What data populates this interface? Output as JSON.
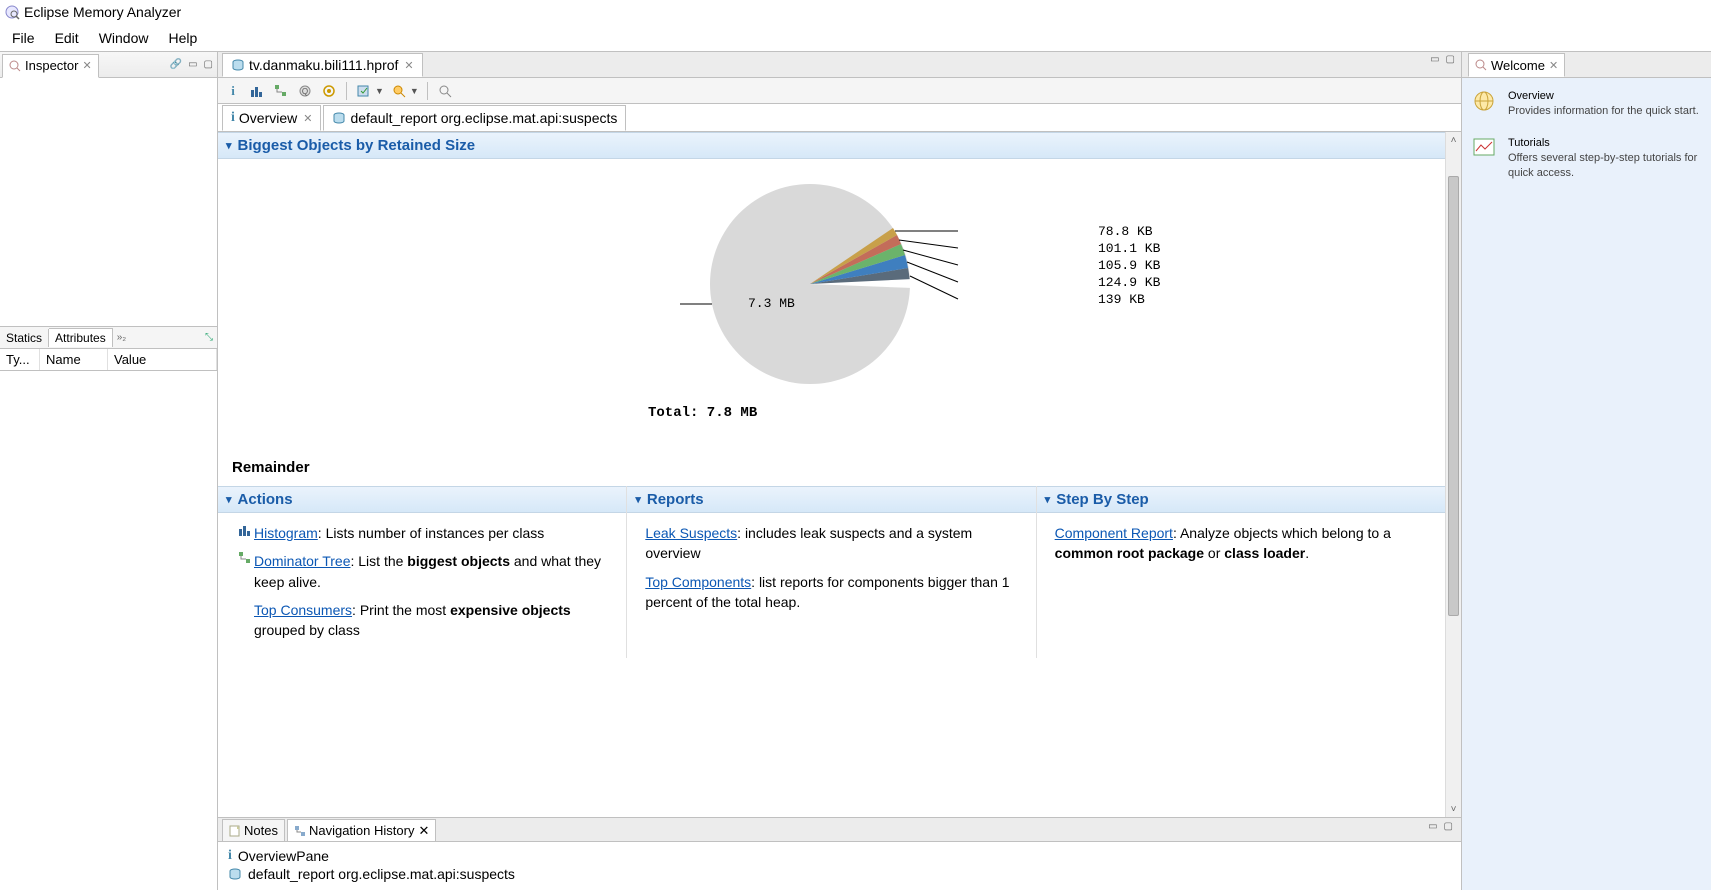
{
  "app_title": "Eclipse Memory Analyzer",
  "menubar": [
    "File",
    "Edit",
    "Window",
    "Help"
  ],
  "left_view": {
    "title": "Inspector"
  },
  "attr_tabs": {
    "statics": "Statics",
    "attributes": "Attributes",
    "col1": "Ty...",
    "col2": "Name",
    "col3": "Value"
  },
  "editor_tab": "tv.danmaku.bili111.hprof",
  "inner_tabs": {
    "overview": "Overview",
    "default_report": "default_report  org.eclipse.mat.api:suspects"
  },
  "sections": {
    "biggest": "Biggest Objects by Retained Size",
    "remainder": "Remainder",
    "actions": "Actions",
    "reports": "Reports",
    "stepbystep": "Step By Step"
  },
  "chart_data": {
    "type": "pie",
    "title": "",
    "total_label": "Total: 7.8 MB",
    "slices": [
      {
        "label": "7.3 MB",
        "value_mb": 7.3,
        "color": "#d9d9d9"
      },
      {
        "label": "78.8 KB",
        "value_kb": 78.8,
        "color": "#c8a04a"
      },
      {
        "label": "101.1 KB",
        "value_kb": 101.1,
        "color": "#c36d5a"
      },
      {
        "label": "105.9 KB",
        "value_kb": 105.9,
        "color": "#6bb36b"
      },
      {
        "label": "124.9 KB",
        "value_kb": 124.9,
        "color": "#3f7fbf"
      },
      {
        "label": "139 KB",
        "value_kb": 139,
        "color": "#5a6b7b"
      }
    ]
  },
  "actions_col": {
    "histogram": {
      "link": "Histogram",
      "rest": ": Lists number of instances per class"
    },
    "dominator": {
      "link": "Dominator Tree",
      "rest1": ": List the ",
      "bold": "biggest objects",
      "rest2": " and what they keep alive."
    },
    "topconsumers": {
      "link": "Top Consumers",
      "rest1": ": Print the most ",
      "bold": "expensive objects",
      "rest2": " grouped by class"
    }
  },
  "reports_col": {
    "leak": {
      "link": "Leak Suspects",
      "rest": ": includes leak suspects and a system overview"
    },
    "topcomp": {
      "link": "Top Components",
      "rest": ": list reports for components bigger than 1 percent of the total heap."
    }
  },
  "step_col": {
    "comprep": {
      "link": "Component Report",
      "rest1": ": Analyze objects which belong to a ",
      "bold1": "common root package",
      "or": " or ",
      "bold2": "class loader",
      "dot": "."
    }
  },
  "bottom": {
    "notes_tab": "Notes",
    "nav_tab": "Navigation History",
    "row1": "OverviewPane",
    "row2": "default_report  org.eclipse.mat.api:suspects"
  },
  "welcome": {
    "tab": "Welcome",
    "overview_title": "Overview",
    "overview_desc": "Provides information for the quick start.",
    "tutorials_title": "Tutorials",
    "tutorials_desc": "Offers several step-by-step tutorials for quick access."
  }
}
